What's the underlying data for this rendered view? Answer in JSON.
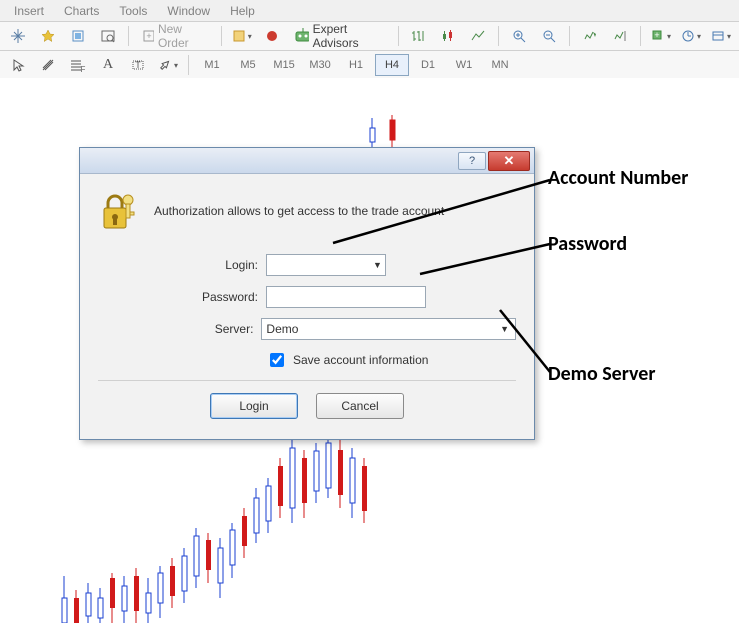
{
  "menu": {
    "insert": "Insert",
    "charts": "Charts",
    "tools": "Tools",
    "window": "Window",
    "help": "Help"
  },
  "toolbar1": {
    "new_order": "New Order",
    "expert_advisors": "Expert Advisors"
  },
  "timeframes": {
    "m1": "M1",
    "m5": "M5",
    "m15": "M15",
    "m30": "M30",
    "h1": "H1",
    "h4": "H4",
    "d1": "D1",
    "w1": "W1",
    "mn": "MN"
  },
  "dialog": {
    "help_symbol": "?",
    "close_symbol": "✕",
    "header_text": "Authorization allows to get access to the trade account",
    "login_label": "Login:",
    "password_label": "Password:",
    "server_label": "Server:",
    "server_value": "Demo",
    "save_label": "Save account information",
    "login_value": "",
    "password_value": "",
    "save_checked": true,
    "btn_login": "Login",
    "btn_cancel": "Cancel"
  },
  "annotations": {
    "account_number": "Account Number",
    "password": "Password",
    "demo_server": "Demo Server"
  }
}
